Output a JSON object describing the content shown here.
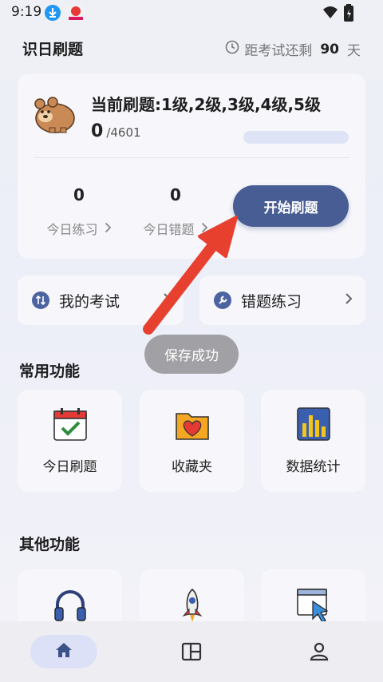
{
  "status_bar": {
    "time": "9:19"
  },
  "header": {
    "title": "识日刷题",
    "countdown_prefix": "距考试还剩",
    "countdown_days": "90",
    "countdown_suffix": "天"
  },
  "practice_card": {
    "subjects": "当前刷题:1级,2级,3级,4级,5级",
    "done": "0",
    "total": "/4601",
    "progress_fraction": 0,
    "today_practice_count": "0",
    "today_practice_label": "今日练习",
    "today_wrong_count": "0",
    "today_wrong_label": "今日错题",
    "start_button": "开始刷题"
  },
  "quick_links": {
    "my_exam": "我的考试",
    "wrong_practice": "错题练习"
  },
  "toast": "保存成功",
  "common": {
    "title": "常用功能",
    "items": [
      "今日刷题",
      "收藏夹",
      "数据统计"
    ]
  },
  "other": {
    "title": "其他功能"
  },
  "colors": {
    "accent": "#485d93",
    "arrow": "#e8402f"
  },
  "icons": {
    "nav": [
      "home-icon",
      "layout-icon",
      "user-icon"
    ]
  }
}
